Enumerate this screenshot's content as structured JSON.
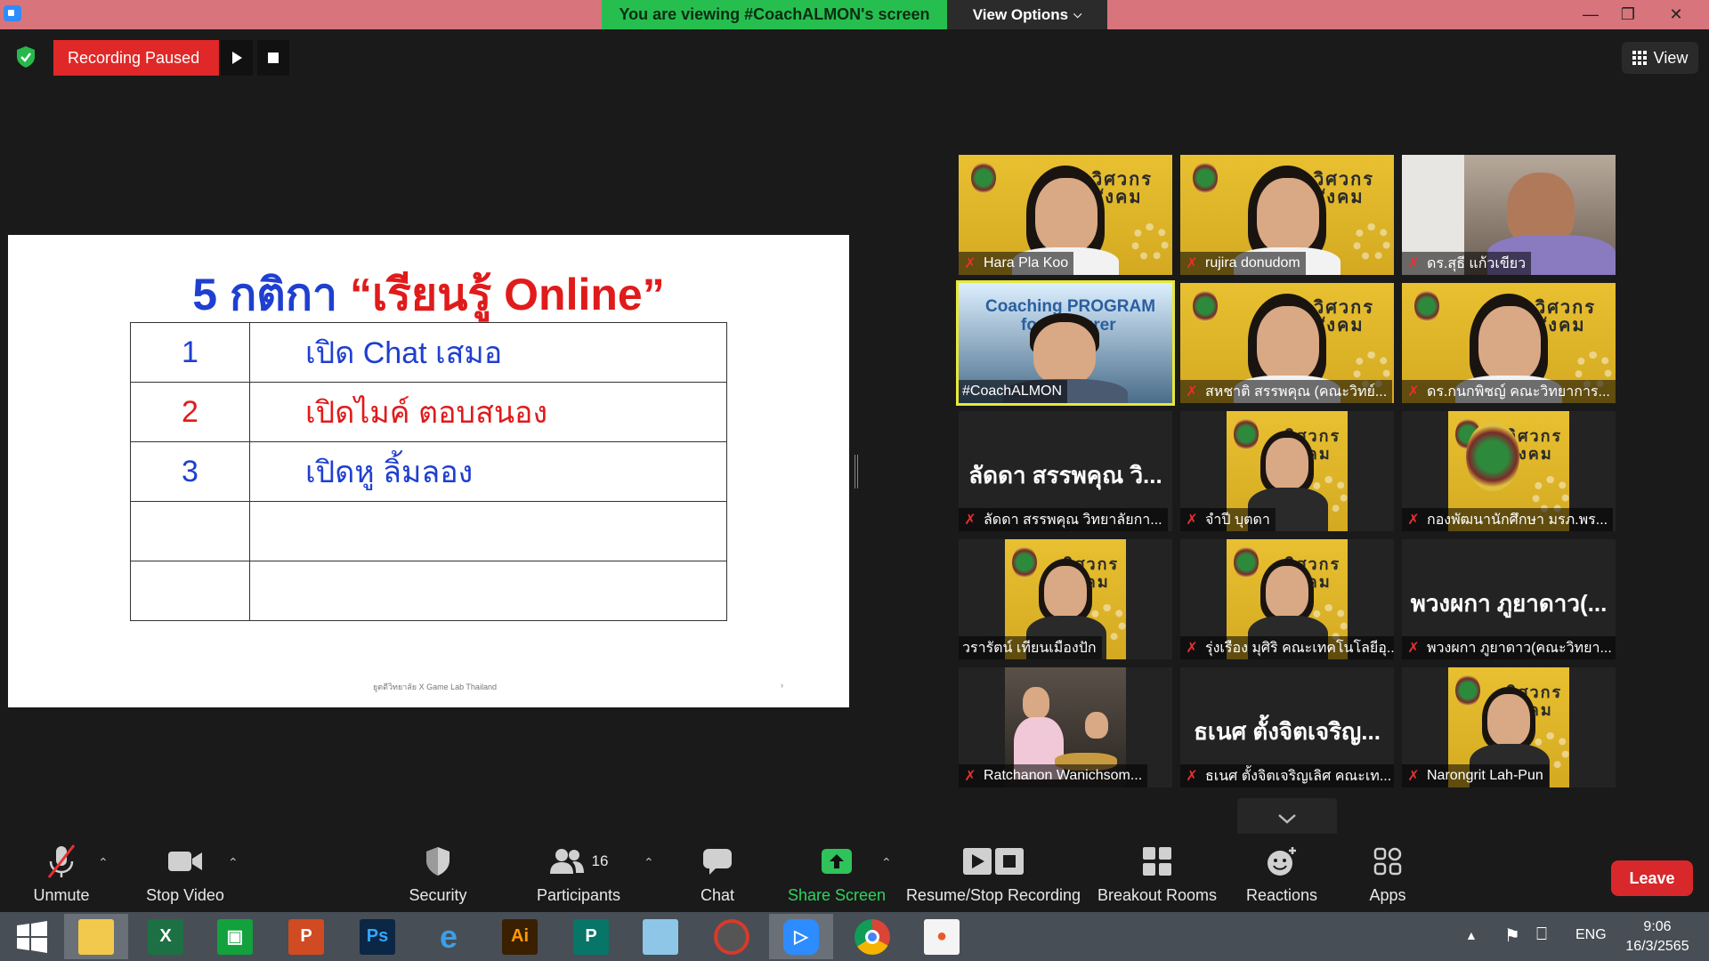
{
  "titlebar": {
    "banner": "You are viewing #CoachALMON's screen",
    "view_options": "View Options",
    "chevron": "chevron-down-icon"
  },
  "recording": {
    "status": "Recording Paused"
  },
  "view_button": {
    "label": "View"
  },
  "slide": {
    "title_part1": "5 กติกา ",
    "title_part2": "“เรียนรู้ Online”",
    "rules": [
      {
        "num": "1",
        "text": "เปิด Chat เสมอ",
        "color": "#1f3fd0"
      },
      {
        "num": "2",
        "text": "เปิดไมค์ ตอบสนอง",
        "color": "#e01b1b"
      },
      {
        "num": "3",
        "text": "เปิดหู ลิ้มลอง",
        "color": "#1f3fd0"
      },
      {
        "num": "",
        "text": ""
      },
      {
        "num": "",
        "text": ""
      }
    ],
    "footer": "ยูตดีวิทยาลัย X Game Lab Thailand",
    "page_dot": "›"
  },
  "gallery": {
    "tiles": [
      {
        "name": "Hara Pla Koo",
        "muted": true
      },
      {
        "name": "rujira donudom",
        "muted": true
      },
      {
        "name": "ดร.สุธี แก้วเขียว",
        "muted": true
      },
      {
        "name": "#CoachALMON",
        "muted": false,
        "active": true,
        "video_text_1": "Coaching PROGRAM",
        "video_text_2": "for Lecturer"
      },
      {
        "name": "สหชาติ สรรพคุณ (คณะวิทย์...",
        "muted": true
      },
      {
        "name": "ดร.กนกพิชญ์ คณะวิทยาการ...",
        "muted": true
      },
      {
        "name": "ลัดดา สรรพคุณ วิทยาลัยกา...",
        "muted": true,
        "big_name": "ลัดดา สรรพคุณ วิ..."
      },
      {
        "name": "จำปี บุตดา",
        "muted": true
      },
      {
        "name": "กองพัฒนานักศึกษา มรภ.พร...",
        "muted": true
      },
      {
        "name": "วรารัตน์ เทียนเมืองปัก",
        "muted": false
      },
      {
        "name": "รุ่งเรือง มุศิริ คณะเทคโนโลยีอุ...",
        "muted": true
      },
      {
        "name": "พวงผกา ภูยาดาว(คณะวิทยา...",
        "muted": true,
        "big_name": "พวงผกา ภูยาดาว(..."
      },
      {
        "name": "Ratchanon Wanichsom...",
        "muted": true
      },
      {
        "name": "ธเนศ ตั้งจิตเจริญเลิศ คณะเท...",
        "muted": true,
        "big_name": "ธเนศ ตั้งจิตเจริญ..."
      },
      {
        "name": "Narongrit Lah-Pun",
        "muted": true
      }
    ],
    "poster_text": "วิศวกร สังคม"
  },
  "controls": {
    "unmute": "Unmute",
    "stop_video": "Stop Video",
    "security": "Security",
    "participants": "Participants",
    "participants_count": "16",
    "chat": "Chat",
    "share_screen": "Share Screen",
    "recording": "Resume/Stop Recording",
    "breakout": "Breakout Rooms",
    "reactions": "Reactions",
    "apps": "Apps",
    "leave": "Leave"
  },
  "taskbar": {
    "apps": [
      "windows-start",
      "file-explorer",
      "excel",
      "store",
      "powerpoint",
      "photoshop",
      "internet-explorer",
      "illustrator",
      "publisher",
      "notepad",
      "photoscape",
      "zoom",
      "chrome",
      "presentation"
    ],
    "language": "ENG",
    "time": "9:06",
    "date": "16/3/2565"
  },
  "colors": {
    "accent_green": "#26bf4f",
    "record_red": "#e02828",
    "leave_red": "#d8282b",
    "active_speaker": "#e6e83a",
    "titlebar": "#d8747c"
  }
}
